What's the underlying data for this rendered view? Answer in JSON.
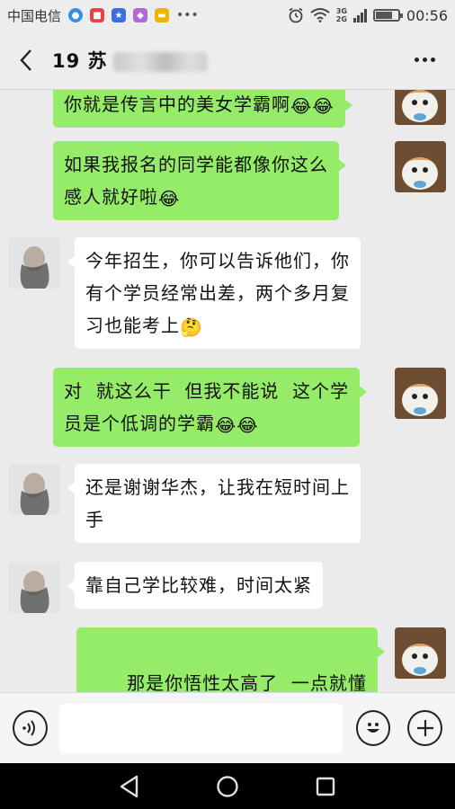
{
  "status_bar": {
    "carrier": "中国电信",
    "network_labels": [
      "3G",
      "2G"
    ],
    "time": "00:56",
    "battery_level": 0.75
  },
  "header": {
    "title": "19 苏",
    "icons": {
      "back": "chevron-left-icon",
      "more": "more-dots-icon"
    }
  },
  "messages": [
    {
      "side": "me",
      "text": "你就是传言中的美女学霸啊",
      "emoji": "😂😂"
    },
    {
      "side": "me",
      "text_lines": [
        "如果我报名的同学能都像你这么",
        "感人就好啦"
      ],
      "emoji": "😂"
    },
    {
      "side": "them",
      "text_lines": [
        "今年招生，你可以告诉他们，你",
        "有个学员经常出差，两个多月复",
        "习也能考上"
      ],
      "emoji": "🤔"
    },
    {
      "side": "me",
      "text_lines": [
        "对  就这么干  但我不能说  这个学",
        "员是个低调的学霸"
      ],
      "emoji": "😂😂"
    },
    {
      "side": "them",
      "text_lines": [
        "还是谢谢华杰，让我在短时间上",
        "手"
      ]
    },
    {
      "side": "them",
      "text": "靠自己学比较难，时间太紧"
    },
    {
      "side": "me",
      "text": "那是你悟性太高了  一点就懂"
    }
  ],
  "input_bar": {
    "placeholder": "",
    "icons": {
      "voice": "voice-icon",
      "emoji": "smiley-icon",
      "more": "plus-icon"
    }
  },
  "nav_bar": {
    "icons": [
      "back-triangle-icon",
      "home-circle-icon",
      "recents-square-icon"
    ]
  },
  "colors": {
    "my_bubble": "#95ec69",
    "their_bubble": "#ffffff",
    "background": "#ebebeb"
  }
}
